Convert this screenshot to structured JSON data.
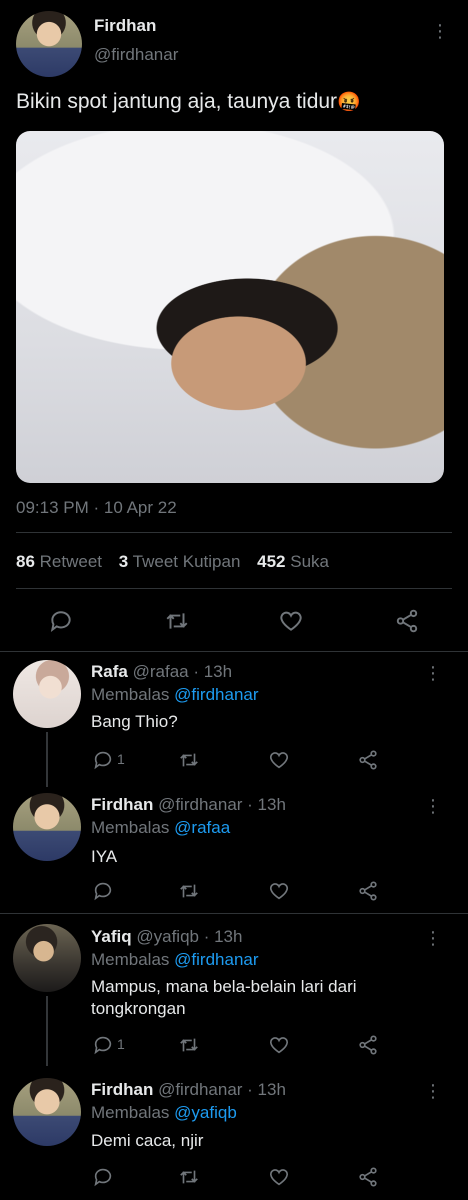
{
  "tweet": {
    "name": "Firdhan",
    "handle": "@firdhanar",
    "text": "Bikin spot jantung aja, taunya tidur",
    "emoji": "🤬",
    "timestamp": "09:13 PM · 10 Apr 22",
    "stats": {
      "retweets_count": "86",
      "retweets_label": "Retweet",
      "quotes_count": "3",
      "quotes_label": "Tweet Kutipan",
      "likes_count": "452",
      "likes_label": "Suka"
    }
  },
  "replies": [
    {
      "name": "Rafa",
      "handle": "@rafaa",
      "time": "· 13h",
      "replying_label": "Membalas",
      "replying_to": "@firdhanar",
      "text": "Bang Thio?",
      "reply_count": "1"
    },
    {
      "name": "Firdhan",
      "handle": "@firdhanar",
      "time": "· 13h",
      "replying_label": "Membalas",
      "replying_to": "@rafaa",
      "text": "IYA",
      "reply_count": ""
    },
    {
      "name": "Yafiq",
      "handle": "@yafiqb",
      "time": "· 13h",
      "replying_label": "Membalas",
      "replying_to": "@firdhanar",
      "text_line1": "Mampus, mana bela-belain lari dari",
      "text_line2": "tongkrongan",
      "reply_count": "1"
    },
    {
      "name": "Firdhan",
      "handle": "@firdhanar",
      "time": "· 13h",
      "replying_label": "Membalas",
      "replying_to": "@yafiqb",
      "text": "Demi caca, njir",
      "reply_count": ""
    }
  ],
  "colors": {
    "background": "#000000",
    "text": "#e7e9ea",
    "muted": "#71767b",
    "link": "#1d9bf0",
    "divider": "#2f3336"
  },
  "icons": [
    "more-icon",
    "reply-icon",
    "retweet-icon",
    "like-icon",
    "share-icon"
  ]
}
